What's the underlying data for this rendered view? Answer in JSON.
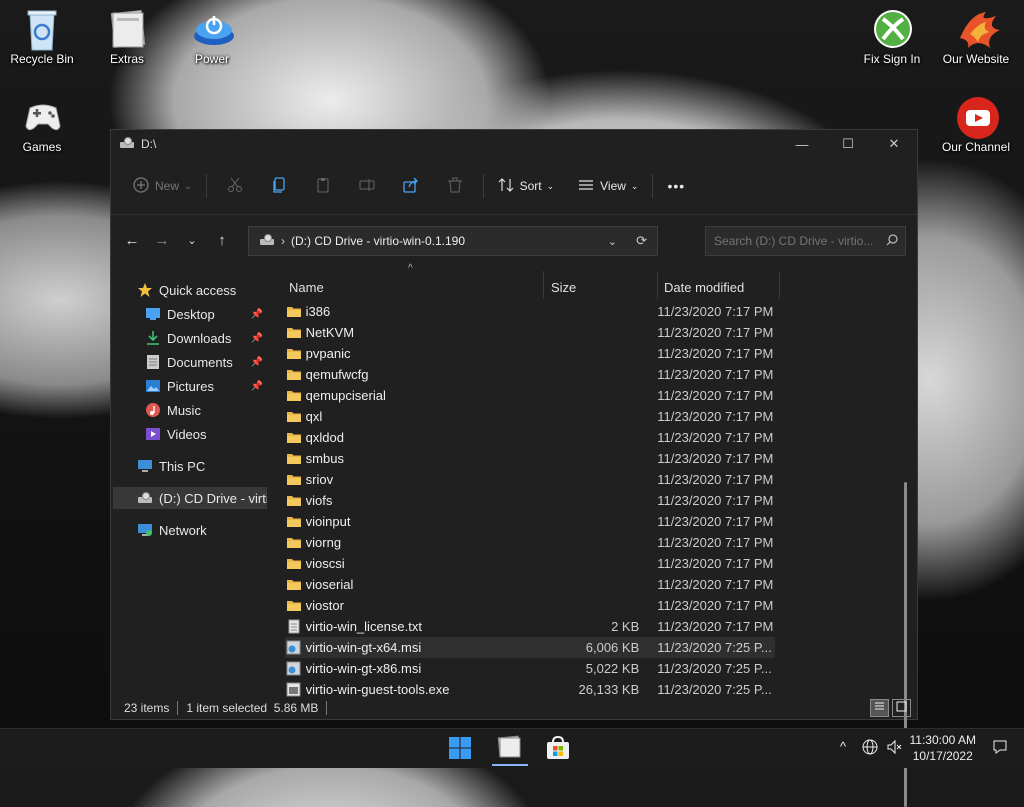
{
  "desktop": {
    "icons": [
      {
        "label": "Recycle Bin"
      },
      {
        "label": "Extras"
      },
      {
        "label": "Power"
      },
      {
        "label": "Games"
      },
      {
        "label": "Fix Sign In"
      },
      {
        "label": "Our Website"
      },
      {
        "label": "Our Channel"
      }
    ]
  },
  "window": {
    "title": "D:\\",
    "controls": {
      "minimize": "—",
      "maximize": "☐",
      "close": "✕"
    }
  },
  "toolbar": {
    "new_label": "New",
    "sort_label": "Sort",
    "view_label": "View",
    "more_label": "•••"
  },
  "address": {
    "path": "(D:) CD Drive - virtio-win-0.1.190",
    "search_placeholder": "Search (D:) CD Drive - virtio..."
  },
  "nav": {
    "quick_access": "Quick access",
    "desktop": "Desktop",
    "downloads": "Downloads",
    "documents": "Documents",
    "pictures": "Pictures",
    "music": "Music",
    "videos": "Videos",
    "this_pc": "This PC",
    "cd_drive": "(D:) CD Drive - virtio-win",
    "network": "Network"
  },
  "columns": {
    "name": "Name",
    "size": "Size",
    "date": "Date modified"
  },
  "files": [
    {
      "name": "i386",
      "size": "",
      "date": "11/23/2020 7:17 PM",
      "type": "folder"
    },
    {
      "name": "NetKVM",
      "size": "",
      "date": "11/23/2020 7:17 PM",
      "type": "folder"
    },
    {
      "name": "pvpanic",
      "size": "",
      "date": "11/23/2020 7:17 PM",
      "type": "folder"
    },
    {
      "name": "qemufwcfg",
      "size": "",
      "date": "11/23/2020 7:17 PM",
      "type": "folder"
    },
    {
      "name": "qemupciserial",
      "size": "",
      "date": "11/23/2020 7:17 PM",
      "type": "folder"
    },
    {
      "name": "qxl",
      "size": "",
      "date": "11/23/2020 7:17 PM",
      "type": "folder"
    },
    {
      "name": "qxldod",
      "size": "",
      "date": "11/23/2020 7:17 PM",
      "type": "folder"
    },
    {
      "name": "smbus",
      "size": "",
      "date": "11/23/2020 7:17 PM",
      "type": "folder"
    },
    {
      "name": "sriov",
      "size": "",
      "date": "11/23/2020 7:17 PM",
      "type": "folder"
    },
    {
      "name": "viofs",
      "size": "",
      "date": "11/23/2020 7:17 PM",
      "type": "folder"
    },
    {
      "name": "vioinput",
      "size": "",
      "date": "11/23/2020 7:17 PM",
      "type": "folder"
    },
    {
      "name": "viorng",
      "size": "",
      "date": "11/23/2020 7:17 PM",
      "type": "folder"
    },
    {
      "name": "vioscsi",
      "size": "",
      "date": "11/23/2020 7:17 PM",
      "type": "folder"
    },
    {
      "name": "vioserial",
      "size": "",
      "date": "11/23/2020 7:17 PM",
      "type": "folder"
    },
    {
      "name": "viostor",
      "size": "",
      "date": "11/23/2020 7:17 PM",
      "type": "folder"
    },
    {
      "name": "virtio-win_license.txt",
      "size": "2 KB",
      "date": "11/23/2020 7:17 PM",
      "type": "txt"
    },
    {
      "name": "virtio-win-gt-x64.msi",
      "size": "6,006 KB",
      "date": "11/23/2020 7:25 P...",
      "type": "msi"
    },
    {
      "name": "virtio-win-gt-x86.msi",
      "size": "5,022 KB",
      "date": "11/23/2020 7:25 P...",
      "type": "msi"
    },
    {
      "name": "virtio-win-guest-tools.exe",
      "size": "26,133 KB",
      "date": "11/23/2020 7:25 P...",
      "type": "exe"
    }
  ],
  "status": {
    "items": "23 items",
    "selected": "1 item selected  5.86 MB"
  },
  "taskbar": {
    "time": "11:30:00 AM",
    "date": "10/17/2022"
  },
  "colors": {
    "folder": "#e8b64a",
    "accent": "#4aa3f0"
  }
}
